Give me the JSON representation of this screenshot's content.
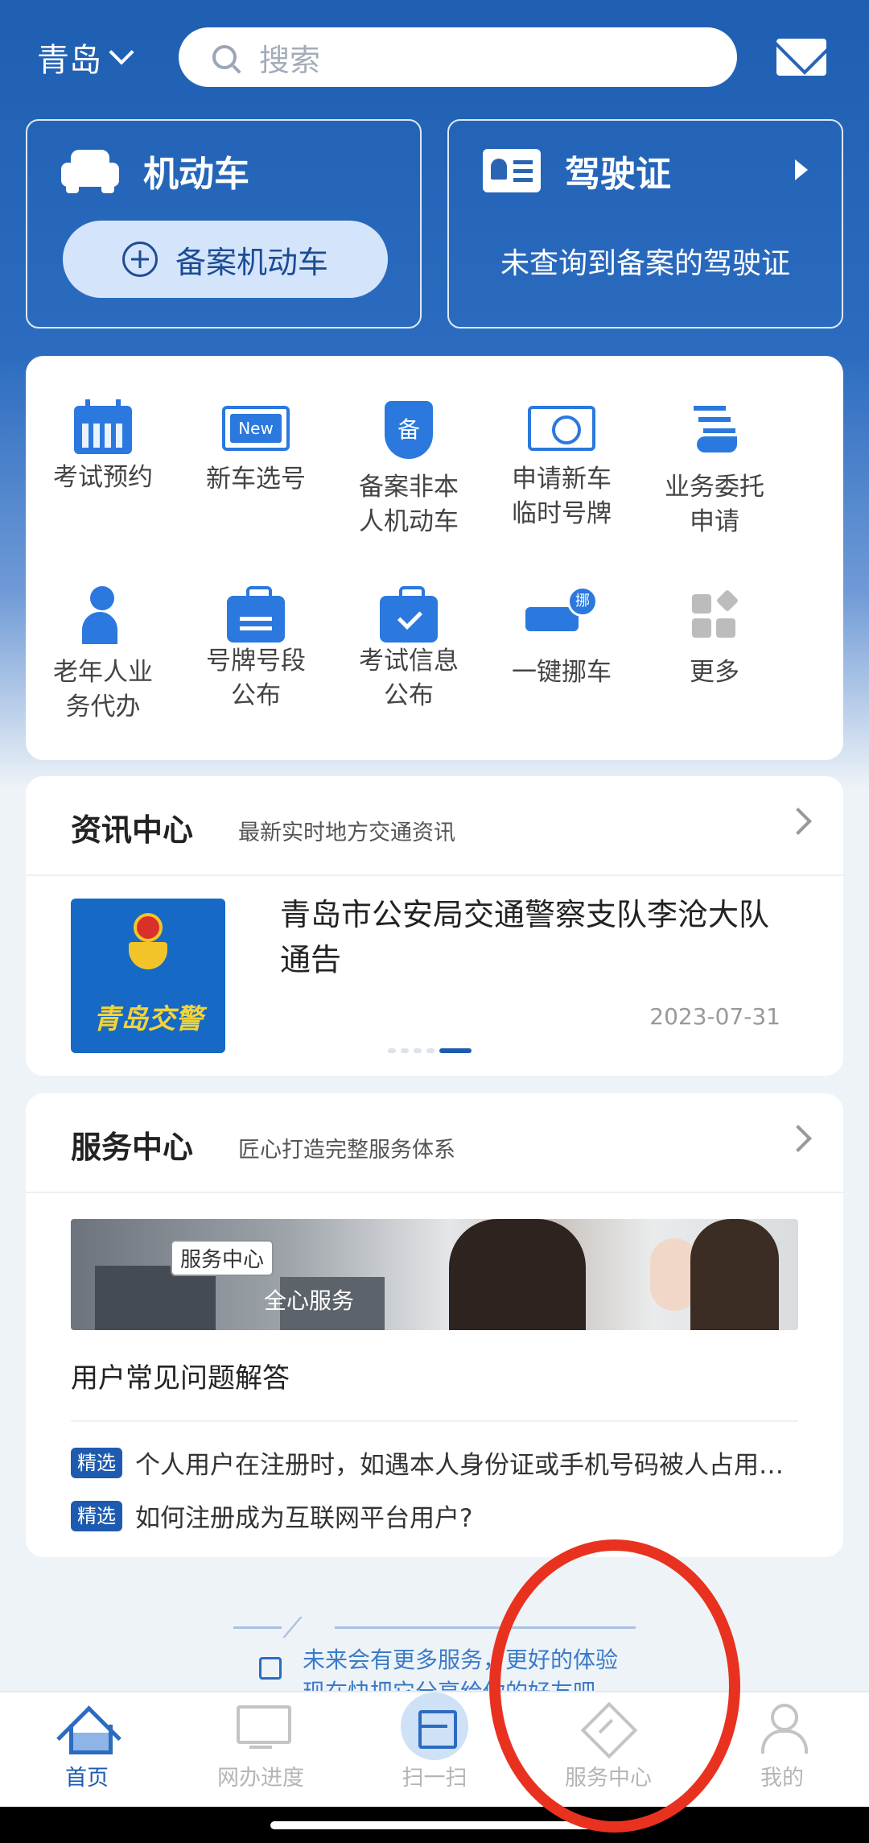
{
  "header": {
    "city": "青岛",
    "search_placeholder": "搜索"
  },
  "vehicle_card": {
    "title": "机动车",
    "register_button": "备案机动车"
  },
  "license_card": {
    "title": "驾驶证",
    "message": "未查询到备案的驾驶证"
  },
  "services": [
    {
      "line1": "考试预约",
      "line2": ""
    },
    {
      "line1": "新车选号",
      "line2": ""
    },
    {
      "line1": "备案非本",
      "line2": "人机动车"
    },
    {
      "line1": "申请新车",
      "line2": "临时号牌"
    },
    {
      "line1": "业务委托",
      "line2": "申请"
    },
    {
      "line1": "老年人业",
      "line2": "务代办"
    },
    {
      "line1": "号牌号段",
      "line2": "公布"
    },
    {
      "line1": "考试信息",
      "line2": "公布"
    },
    {
      "line1": "一键挪车",
      "line2": ""
    },
    {
      "line1": "更多",
      "line2": ""
    }
  ],
  "icons": {
    "new_badge": "New",
    "shield_char": "备",
    "move_char": "挪"
  },
  "news": {
    "title": "资讯中心",
    "subtitle": "最新实时地方交通资讯",
    "image_text": "青岛交警",
    "headline": "青岛市公安局交通警察支队李沧大队通告",
    "date": "2023-07-31"
  },
  "service_center": {
    "title": "服务中心",
    "subtitle": "匠心打造完整服务体系",
    "banner_tag": "服务中心",
    "banner_text": "全心服务",
    "faq_title": "用户常见问题解答",
    "badge": "精选",
    "faqs": [
      "个人用户在注册时，如遇本人身份证或手机号码被人占用，如何处理？",
      "如何注册成为互联网平台用户?"
    ]
  },
  "promo": {
    "line1": "未来会有更多服务，更好的体验",
    "line2": "现在快把它分享给你的好友吧"
  },
  "tabbar": {
    "home": "首页",
    "progress": "网办进度",
    "scan": "扫一扫",
    "service": "服务中心",
    "mine": "我的"
  },
  "colors": {
    "primary": "#1e5bb0",
    "accent": "#2b78de",
    "annotation": "#e8321f"
  }
}
